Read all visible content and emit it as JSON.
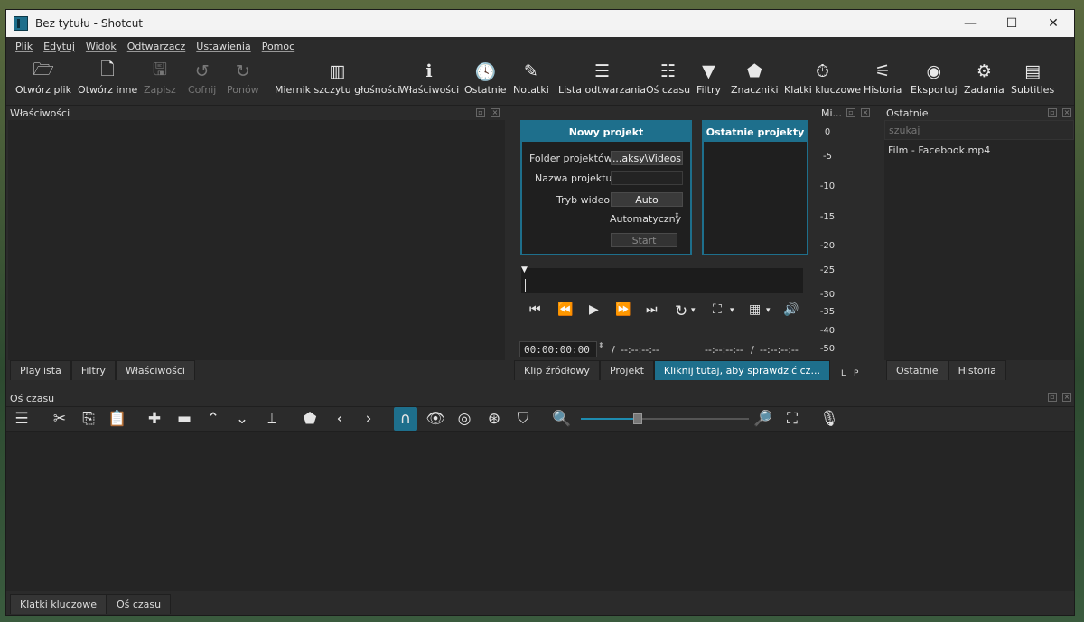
{
  "window": {
    "title": "Bez tytułu - Shotcut"
  },
  "window_controls": [
    "—",
    "☐",
    "✕"
  ],
  "menu": [
    "Plik",
    "Edytuj",
    "Widok",
    "Odtwarzacz",
    "Ustawienia",
    "Pomoc"
  ],
  "toolbar": [
    {
      "label": "Otwórz plik",
      "icon": "folder-open-icon",
      "glyph": "🗁",
      "disabled": false
    },
    {
      "label": "Otwórz inne",
      "icon": "file-plus-icon",
      "glyph": "🗋",
      "disabled": false
    },
    {
      "label": "Zapisz",
      "icon": "save-icon",
      "glyph": "🖫",
      "disabled": true
    },
    {
      "label": "Cofnij",
      "icon": "undo-icon",
      "glyph": "↺",
      "disabled": true
    },
    {
      "label": "Ponów",
      "icon": "redo-icon",
      "glyph": "↻",
      "disabled": true
    },
    {
      "label": "Miernik szczytu głośności",
      "icon": "peak-meter-icon",
      "glyph": "▥",
      "disabled": false
    },
    {
      "label": "Właściwości",
      "icon": "info-icon",
      "glyph": "ℹ",
      "disabled": false
    },
    {
      "label": "Ostatnie",
      "icon": "clock-icon",
      "glyph": "🕓",
      "disabled": false
    },
    {
      "label": "Notatki",
      "icon": "notes-icon",
      "glyph": "✎",
      "disabled": false
    },
    {
      "label": "Lista odtwarzania",
      "icon": "list-icon",
      "glyph": "☰",
      "disabled": false
    },
    {
      "label": "Oś czasu",
      "icon": "timeline-icon",
      "glyph": "☷",
      "disabled": false
    },
    {
      "label": "Filtry",
      "icon": "filter-icon",
      "glyph": "▼",
      "disabled": false
    },
    {
      "label": "Znaczniki",
      "icon": "marker-icon",
      "glyph": "⬟",
      "disabled": false
    },
    {
      "label": "Klatki kluczowe",
      "icon": "stopwatch-icon",
      "glyph": "⏱",
      "disabled": false
    },
    {
      "label": "Historia",
      "icon": "history-icon",
      "glyph": "⚟",
      "disabled": false
    },
    {
      "label": "Eksportuj",
      "icon": "export-disc-icon",
      "glyph": "◉",
      "disabled": false
    },
    {
      "label": "Zadania",
      "icon": "gear-icon",
      "glyph": "⚙",
      "disabled": false
    },
    {
      "label": "Subtitles",
      "icon": "subtitles-icon",
      "glyph": "▤",
      "disabled": false
    }
  ],
  "properties_panel": {
    "title": "Właściwości"
  },
  "left_tabs": [
    "Playlista",
    "Filtry",
    "Właściwości"
  ],
  "new_project": {
    "title": "Nowy projekt",
    "folder_label": "Folder projektów",
    "folder_value": "...aksy\\Videos",
    "name_label": "Nazwa projektu",
    "name_value": "",
    "video_mode_label": "Tryb wideo",
    "video_mode_value": "Auto",
    "auto_value": "Automatyczny",
    "start_label": "Start"
  },
  "recent_projects": {
    "title": "Ostatnie projekty"
  },
  "player": {
    "timecode": "00:00:00:00",
    "duration": "--:--:--:--",
    "in_point": "--:--:--:--",
    "out_point": "--:--:--:--",
    "separator": "/"
  },
  "player_tabs": [
    "Klip źródłowy",
    "Projekt",
    "Kliknij tutaj, aby sprawdzić cz..."
  ],
  "meter": {
    "title": "Mi...",
    "scale": [
      "0",
      "-5",
      "-10",
      "-15",
      "-20",
      "-25",
      "-30",
      "-35",
      "-40",
      "-50"
    ],
    "channels": [
      "L",
      "P"
    ]
  },
  "recent_panel": {
    "title": "Ostatnie",
    "search_placeholder": "szukaj",
    "items": [
      "Film - Facebook.mp4"
    ]
  },
  "right_tabs": [
    "Ostatnie",
    "Historia"
  ],
  "timeline": {
    "title": "Oś czasu"
  },
  "bottom_tabs": [
    "Klatki kluczowe",
    "Oś czasu"
  ]
}
